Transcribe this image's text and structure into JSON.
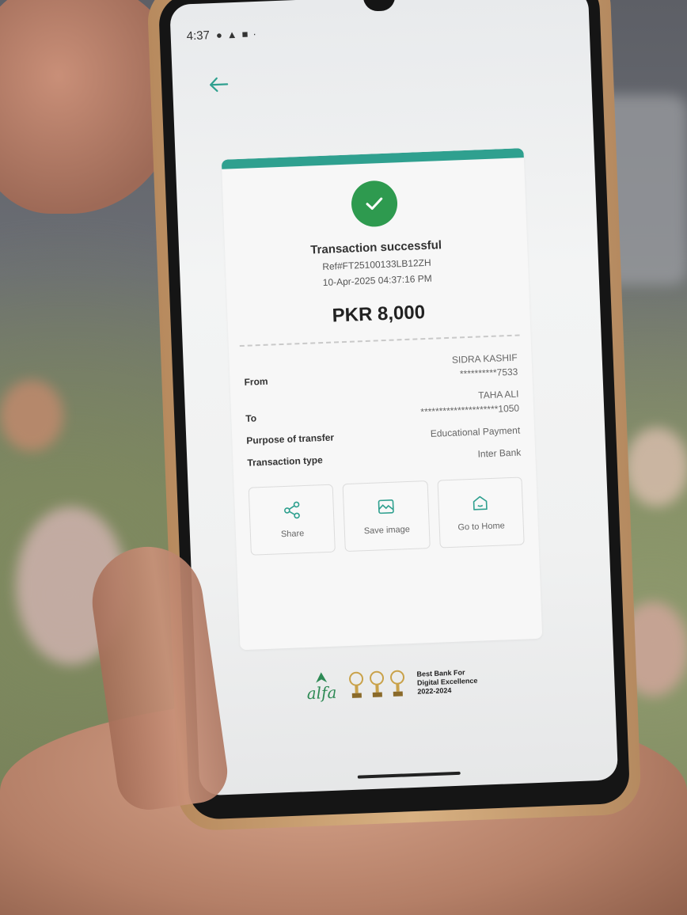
{
  "status_bar": {
    "time": "4:37"
  },
  "receipt": {
    "title": "Transaction successful",
    "ref": "Ref#FT25100133LB12ZH",
    "datetime": "10-Apr-2025 04:37:16 PM",
    "amount": "PKR 8,000",
    "rows": [
      {
        "label": "From",
        "values": [
          "SIDRA KASHIF",
          "**********7533"
        ]
      },
      {
        "label": "To",
        "values": [
          "TAHA ALI",
          "*********************1050"
        ]
      },
      {
        "label": "Purpose of transfer",
        "values": [
          "Educational Payment"
        ]
      },
      {
        "label": "Transaction type",
        "values": [
          "Inter Bank"
        ]
      }
    ],
    "actions": [
      {
        "label": "Share",
        "icon": "share-icon"
      },
      {
        "label": "Save image",
        "icon": "image-icon"
      },
      {
        "label": "Go to Home",
        "icon": "home-icon"
      }
    ]
  },
  "branding": {
    "logo_text": "alfa",
    "award_line1": "Best Bank For",
    "award_line2": "Digital Excellence",
    "award_line3": "2022-2024"
  },
  "colors": {
    "accent": "#2fa08f",
    "success": "#2e9a4f"
  }
}
